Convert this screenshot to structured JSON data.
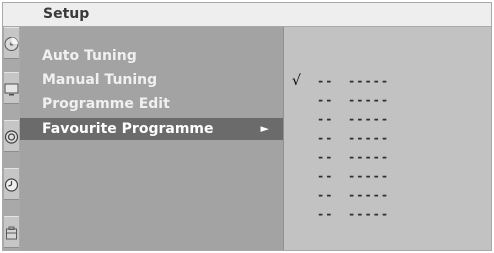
{
  "menu": {
    "title": "Setup",
    "items": [
      {
        "label": "Auto Tuning",
        "selected": false
      },
      {
        "label": "Manual Tuning",
        "selected": false
      },
      {
        "label": "Programme Edit",
        "selected": false
      },
      {
        "label": "Favourite Programme",
        "selected": true
      }
    ],
    "arrow_glyph": "►"
  },
  "sidebar_icons": [
    {
      "name": "setup-disc-icon"
    },
    {
      "name": "tv-screen-icon"
    },
    {
      "name": "audio-speaker-icon"
    },
    {
      "name": "clock-icon"
    },
    {
      "name": "special-options-icon"
    }
  ],
  "favourites": {
    "check_glyph": "√",
    "rows": [
      {
        "number": "--",
        "name": "-----",
        "checked": true
      },
      {
        "number": "--",
        "name": "-----",
        "checked": false
      },
      {
        "number": "--",
        "name": "-----",
        "checked": false
      },
      {
        "number": "--",
        "name": "-----",
        "checked": false
      },
      {
        "number": "--",
        "name": "-----",
        "checked": false
      },
      {
        "number": "--",
        "name": "-----",
        "checked": false
      },
      {
        "number": "--",
        "name": "-----",
        "checked": false
      },
      {
        "number": "--",
        "name": "-----",
        "checked": false
      }
    ]
  },
  "colors": {
    "title_bg": "#eeeeee",
    "menu_bg": "#a3a3a3",
    "selected_bg": "#6b6b6b",
    "list_bg": "#c2c2c2"
  }
}
